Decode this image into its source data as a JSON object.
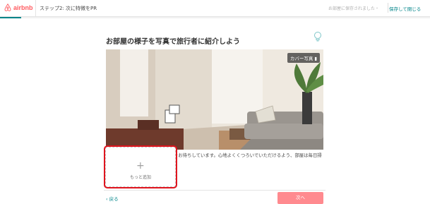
{
  "header": {
    "logo_text": "airbnb",
    "step_title": "ステップ2: 次に特徴をPR",
    "saved_status": "お部屋に保存されました・",
    "save_exit_label": "保存して閉じる",
    "progress_fraction": 0.05
  },
  "main": {
    "title": "お部屋の様子を写真で旅行者に紹介しよう",
    "cover_badge": "カバー写真",
    "photo_description": "日当たりのよいリビングでお客様をお待ちしています。心地よくくつろいでいただけるよう、部屋は毎日掃除し、清潔を心がけています。",
    "add_more_label": "もっと追加"
  },
  "footer": {
    "back_label": "‹ 戻る",
    "next_label": "次へ"
  },
  "colors": {
    "brand": "#ff5a5f",
    "accent": "#008489",
    "next_button": "#ff8a8f",
    "highlight": "#e0141e"
  }
}
